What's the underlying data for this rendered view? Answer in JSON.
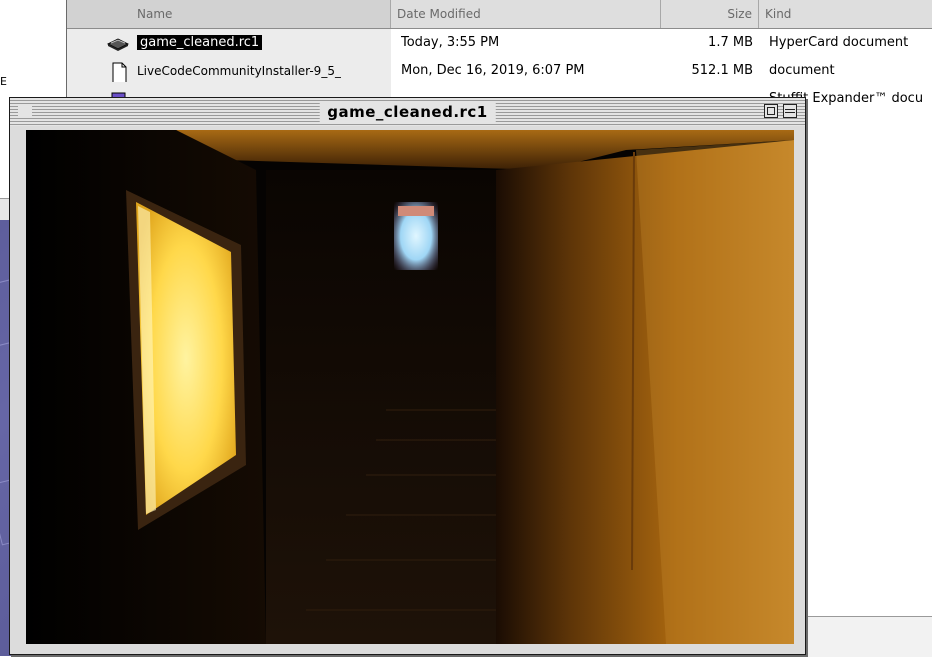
{
  "desktop": {
    "left_pane_letter": "E"
  },
  "finder": {
    "columns": {
      "name": "Name",
      "date": "Date Modified",
      "size": "Size",
      "kind": "Kind"
    },
    "rows": [
      {
        "name": "game_cleaned.rc1",
        "date": "Today, 3:55 PM",
        "size": "1.7 MB",
        "kind": "HyperCard document",
        "icon": "hypercard-stack-icon",
        "selected": true
      },
      {
        "name": "LiveCodeCommunityInstaller-9_5_",
        "date": "Mon, Dec 16, 2019, 6:07 PM",
        "size": "512.1 MB",
        "kind": "document",
        "icon": "document-icon",
        "selected": false
      },
      {
        "name": "",
        "date": "",
        "size": "",
        "kind": "Stuffit Expander™ docu",
        "icon": "stuffit-archive-icon",
        "selected": false
      }
    ]
  },
  "game_window": {
    "title": "game_cleaned.rc1"
  },
  "scene": {
    "description_colors": {
      "wall_light": "#c47f1c",
      "window_glow": "#ffe060",
      "sky": "#bfe8ff",
      "dark": "#050302"
    }
  }
}
